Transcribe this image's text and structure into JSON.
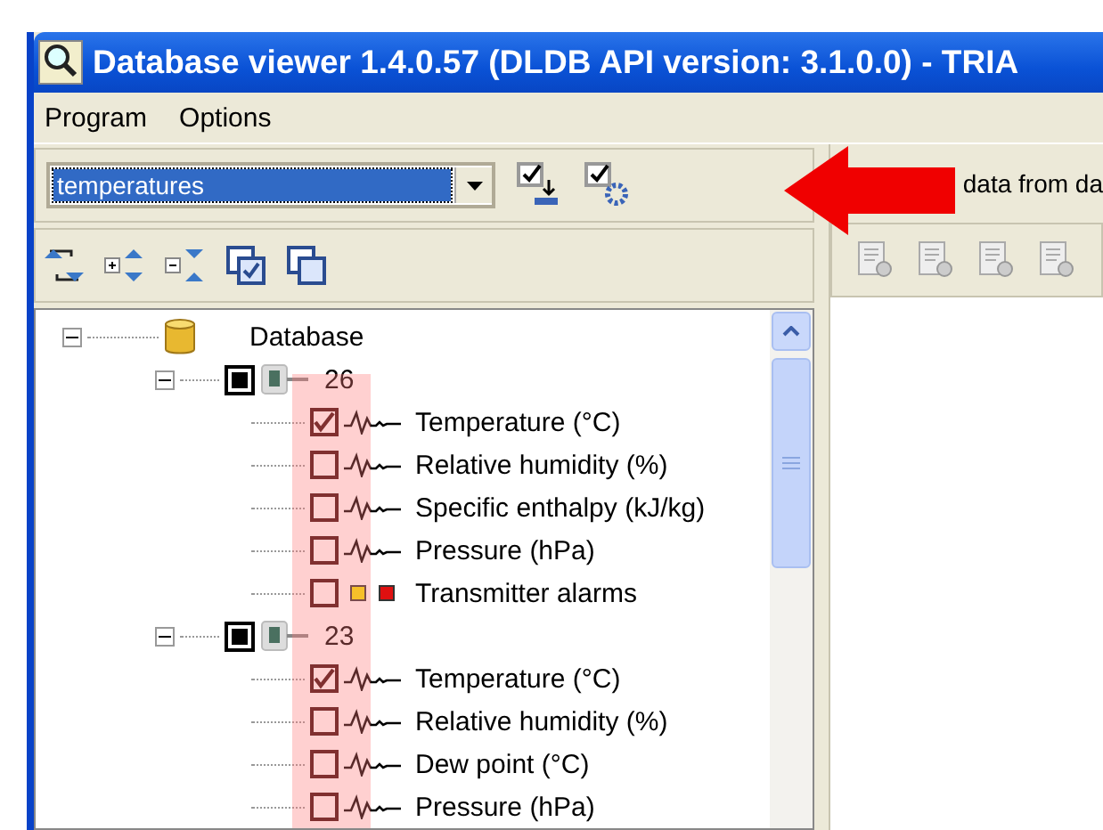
{
  "window": {
    "title": "Database viewer  1.4.0.57  (DLDB API version: 3.1.0.0) - TRIA"
  },
  "menu": [
    "Program",
    "Options"
  ],
  "selector": {
    "value": "temperatures"
  },
  "right_panel": {
    "text": "data from da"
  },
  "tree": {
    "label": "Database",
    "expanded": true,
    "children": [
      {
        "label": "26",
        "expanded": true,
        "partial": true,
        "children": [
          {
            "kind": "signal",
            "label": "Temperature (°C)",
            "checked": true
          },
          {
            "kind": "signal",
            "label": "Relative humidity (%)",
            "checked": false
          },
          {
            "kind": "signal",
            "label": "Specific enthalpy (kJ/kg)",
            "checked": false
          },
          {
            "kind": "signal",
            "label": "Pressure (hPa)",
            "checked": false
          },
          {
            "kind": "alarm",
            "label": "Transmitter alarms",
            "checked": false
          }
        ]
      },
      {
        "label": "23",
        "expanded": true,
        "partial": true,
        "children": [
          {
            "kind": "signal",
            "label": "Temperature (°C)",
            "checked": true
          },
          {
            "kind": "signal",
            "label": "Relative humidity (%)",
            "checked": false
          },
          {
            "kind": "signal",
            "label": "Dew point (°C)",
            "checked": false
          },
          {
            "kind": "signal",
            "label": "Pressure (hPa)",
            "checked": false
          }
        ]
      }
    ]
  }
}
